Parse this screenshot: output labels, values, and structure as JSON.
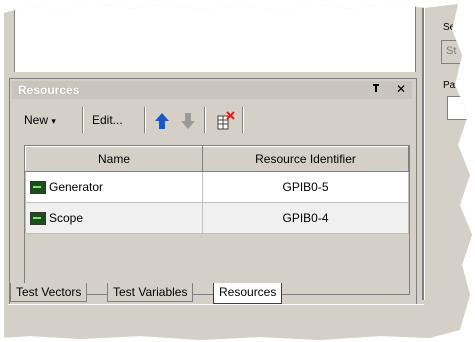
{
  "right_panel": {
    "label_top": "Se",
    "box_text": "St",
    "label_pause": "Pau"
  },
  "panel": {
    "title": "Resources",
    "pin_glyph": "ᴿ",
    "close_glyph": "✕"
  },
  "toolbar": {
    "new_label": "New",
    "new_caret": "▾",
    "edit_label": "Edit...",
    "up_icon": "arrow-up",
    "down_icon": "arrow-down",
    "delete_icon": "delete-columns"
  },
  "grid": {
    "columns": [
      "Name",
      "Resource Identifier"
    ],
    "rows": [
      {
        "name": "Generator",
        "id": "GPIB0-5"
      },
      {
        "name": "Scope",
        "id": "GPIB0-4"
      }
    ]
  },
  "tabs": [
    {
      "label": "Test Vectors",
      "active": false
    },
    {
      "label": "Test Variables",
      "active": false
    },
    {
      "label": "Resources",
      "active": true
    }
  ],
  "colors": {
    "up_arrow": "#1c56c8",
    "down_arrow": "#9a9a9a",
    "delete_x": "#e0201c"
  }
}
